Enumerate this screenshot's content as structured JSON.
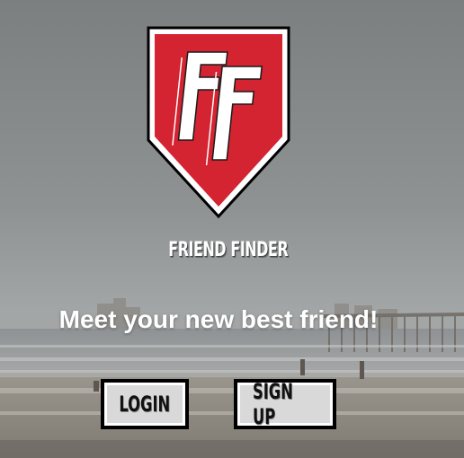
{
  "app": {
    "logo_letters": "FF",
    "brand_name": "FRIEND FINDER",
    "tagline": "Meet your new best friend!"
  },
  "actions": {
    "login_label": "LOGIN",
    "signup_label": "SIGN UP"
  },
  "colors": {
    "shield_red": "#d42331",
    "shield_border": "#000000",
    "text": "#ffffff",
    "button_bg": "#d9d9d9"
  }
}
